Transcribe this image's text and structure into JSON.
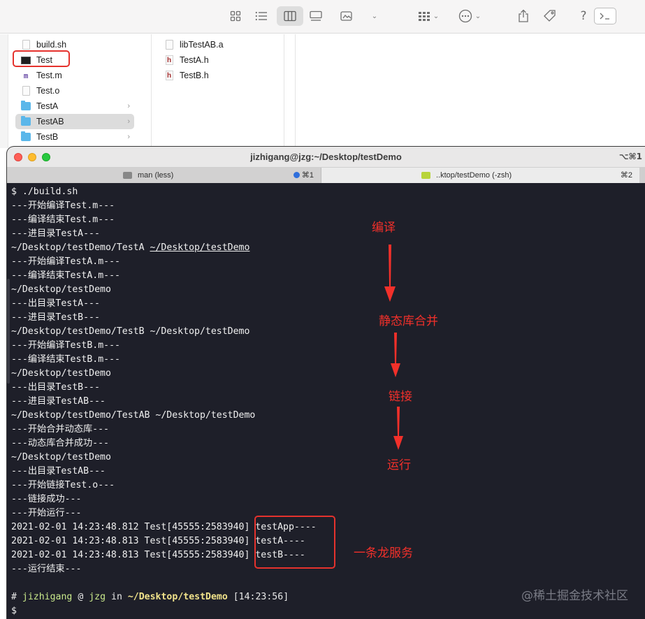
{
  "finder": {
    "col1": [
      {
        "name": "build.sh",
        "icon": "doc-icon",
        "folder": false,
        "selected": false
      },
      {
        "name": "Test",
        "icon": "executable-icon",
        "folder": false,
        "selected": false
      },
      {
        "name": "Test.m",
        "icon": "m-file-icon",
        "folder": false,
        "selected": false
      },
      {
        "name": "Test.o",
        "icon": "doc-icon",
        "folder": false,
        "selected": false
      },
      {
        "name": "TestA",
        "icon": "folder-icon",
        "folder": true,
        "selected": false
      },
      {
        "name": "TestAB",
        "icon": "folder-icon",
        "folder": true,
        "selected": true
      },
      {
        "name": "TestB",
        "icon": "folder-icon",
        "folder": true,
        "selected": false
      }
    ],
    "col2": [
      {
        "name": "libTestAB.a",
        "icon": "doc-icon"
      },
      {
        "name": "TestA.h",
        "icon": "h-file-icon"
      },
      {
        "name": "TestB.h",
        "icon": "h-file-icon"
      }
    ],
    "icon_h_letter": "h",
    "icon_m_letter": "m"
  },
  "terminal": {
    "title": "jizhigang@jzg:~/Desktop/testDemo",
    "shortcut": "⌥⌘1",
    "tabs": [
      {
        "label": "man (less)",
        "kbd": "⌘1"
      },
      {
        "label": "..ktop/testDemo (-zsh)",
        "kbd": "⌘2"
      }
    ],
    "lines": [
      "$ ./build.sh",
      "---开始编译Test.m---",
      "---编译结束Test.m---",
      "---进目录TestA---",
      "~/Desktop/testDemo/TestA ",
      "---开始编译TestA.m---",
      "---编译结束TestA.m---",
      "~/Desktop/testDemo",
      "---出目录TestA---",
      "---进目录TestB---",
      "~/Desktop/testDemo/TestB ~/Desktop/testDemo",
      "---开始编译TestB.m---",
      "---编译结束TestB.m---",
      "~/Desktop/testDemo",
      "---出目录TestB---",
      "---进目录TestAB---",
      "~/Desktop/testDemo/TestAB ~/Desktop/testDemo",
      "---开始合并动态库---",
      "---动态库合并成功---",
      "~/Desktop/testDemo",
      "---出目录TestAB---",
      "---开始链接Test.o---",
      "---链接成功---",
      "---开始运行---",
      "2021-02-01 14:23:48.812 Test[45555:2583940] testApp----",
      "2021-02-01 14:23:48.813 Test[45555:2583940] testA----",
      "2021-02-01 14:23:48.813 Test[45555:2583940] testB----",
      "---运行结束---"
    ],
    "underlined_dir": "~/Desktop/testDemo",
    "prompt": {
      "hash": "#",
      "user": "jizhigang",
      "at": "@",
      "host": "jzg",
      "in": "in",
      "dir": "~/Desktop/testDemo",
      "time": "[14:23:56]"
    },
    "cursor_line": "$"
  },
  "annotations": {
    "compile": "编译",
    "static_merge": "静态库合并",
    "link": "链接",
    "run": "运行",
    "one_stop": "一条龙服务"
  },
  "watermark": "@稀土掘金技术社区",
  "colors": {
    "annotation_red": "#f2302a",
    "terminal_bg": "#1e1f29",
    "folder_blue": "#5bb7ea"
  }
}
